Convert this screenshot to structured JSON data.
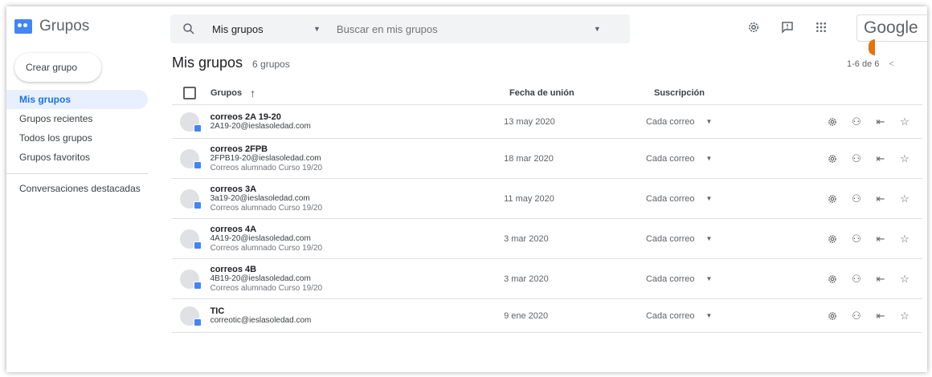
{
  "app": {
    "name": "Grupos",
    "brand": "Google"
  },
  "search": {
    "scope": "Mis grupos",
    "placeholder": "Buscar en mis grupos"
  },
  "sidebar": {
    "create_label": "Crear grupo",
    "items": [
      {
        "label": "Mis grupos",
        "active": true
      },
      {
        "label": "Grupos recientes"
      },
      {
        "label": "Todos los grupos"
      },
      {
        "label": "Grupos favoritos"
      }
    ],
    "secondary": [
      {
        "label": "Conversaciones destacadas"
      }
    ]
  },
  "main": {
    "title": "Mis grupos",
    "count": "6 grupos",
    "pagination": "1-6 de 6",
    "columns": {
      "groups": "Grupos",
      "date": "Fecha de unión",
      "subscription": "Suscripción"
    },
    "rows": [
      {
        "name": "correos 2A 19-20",
        "email": "2A19-20@ieslasoledad.com",
        "desc": "",
        "date": "13 may 2020",
        "subscription": "Cada correo"
      },
      {
        "name": "correos 2FPB",
        "email": "2FPB19-20@ieslasoledad.com",
        "desc": "Correos alumnado Curso 19/20",
        "date": "18 mar 2020",
        "subscription": "Cada correo"
      },
      {
        "name": "correos 3A",
        "email": "3a19-20@ieslasoledad.com",
        "desc": "Correos alumnado Curso 19/20",
        "date": "11 may 2020",
        "subscription": "Cada correo"
      },
      {
        "name": "correos 4A",
        "email": "4A19-20@ieslasoledad.com",
        "desc": "Correos alumnado Curso 19/20",
        "date": "3 mar 2020",
        "subscription": "Cada correo"
      },
      {
        "name": "correos 4B",
        "email": "4B19-20@ieslasoledad.com",
        "desc": "Correos alumnado Curso 19/20",
        "date": "3 mar 2020",
        "subscription": "Cada correo"
      },
      {
        "name": "TIC",
        "email": "correotic@ieslasoledad.com",
        "desc": "",
        "date": "9 ene 2020",
        "subscription": "Cada correo"
      }
    ]
  },
  "icons": {
    "search": "search-icon",
    "settings": "gear-icon",
    "feedback": "feedback-icon",
    "apps": "apps-grid-icon",
    "row_actions": [
      "gear-icon",
      "add-member-icon",
      "leave-group-icon",
      "star-icon"
    ]
  },
  "colors": {
    "accent": "#1a73e8",
    "active_bg": "#e8f0fe",
    "logo": "#4285f4"
  }
}
